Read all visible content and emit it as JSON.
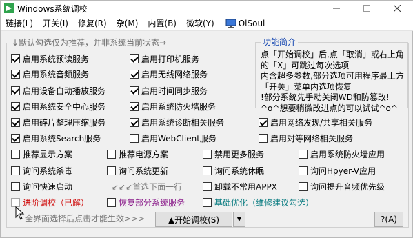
{
  "window": {
    "title": "Windows系统调校"
  },
  "menu": [
    {
      "label": "链接(L)"
    },
    {
      "label": "开关(I)"
    },
    {
      "label": "修复(R)"
    },
    {
      "label": "杂(M)"
    },
    {
      "label": "内置(B)"
    },
    {
      "label": "微软(Y)"
    },
    {
      "label": "OlSoul"
    }
  ],
  "options_group": {
    "legend": "↓默认勾选仅为推荐，并非系统当前状态→"
  },
  "info": {
    "legend": "功能简介",
    "text": "点「开始调校」后,点「取消」或右上角的「X」可跳过每次选项\n内含超多参数,部分选项可用程序最上方「开关」菜单内选项恢复\n!部分系统先手动关闭WD和防篡改!\n^o^想要稍微改进点的可以试试^o^"
  },
  "checkboxes": [
    {
      "label": "启用系统预读服务",
      "checked": true
    },
    {
      "label": "启用打印机服务",
      "checked": true
    },
    {
      "label": "启用系统音频服务",
      "checked": true
    },
    {
      "label": "启用无线网络服务",
      "checked": true
    },
    {
      "label": "启用设备自动播放服务",
      "checked": true
    },
    {
      "label": "启用时间同步服务",
      "checked": true
    },
    {
      "label": "启用系统安全中心服务",
      "checked": true
    },
    {
      "label": "启用系统防火墙服务",
      "checked": true
    },
    {
      "label": "启用碎片整理压缩服务",
      "checked": true
    },
    {
      "label": "启用系统诊断相关服务",
      "checked": true
    },
    {
      "label": "启用网络发现/共享相关服务",
      "checked": true
    },
    {
      "label": "启用系统Search服务",
      "checked": true
    },
    {
      "label": "启用WebClient服务",
      "checked": false
    },
    {
      "label": "启用对等网络相关服务",
      "checked": false
    },
    {
      "label": "推荐显示方案",
      "checked": false
    },
    {
      "label": "推荐电源方案",
      "checked": false
    },
    {
      "label": "禁用更多服务",
      "checked": false
    },
    {
      "label": "启用系统防火墙应用",
      "checked": false
    },
    {
      "label": "询问系统杀毒",
      "checked": false
    },
    {
      "label": "询问系统更新",
      "checked": false
    },
    {
      "label": "询问系统休眠",
      "checked": false
    },
    {
      "label": "询问Hpyer-V应用",
      "checked": false
    },
    {
      "label": "询问快速启动",
      "checked": false
    },
    {
      "label": "卸载不常用APPX",
      "checked": false
    },
    {
      "label": "询问提升音频优先级",
      "checked": false
    },
    {
      "label": "进阶调校（已解）",
      "checked": false
    },
    {
      "label": "恢复部分系统服务",
      "checked": false
    },
    {
      "label": "基础优化（维修建议勾选）",
      "checked": false
    }
  ],
  "hints": {
    "first_select": "↙↙↙首选下面一行",
    "footer": "全界面选择后点击才能生效>>>"
  },
  "buttons": {
    "start": "▲开始调校(S)",
    "start_arrow": "▼",
    "help": "?(A)"
  },
  "colors": {
    "red": "#d01010",
    "purple": "#8a1b8a",
    "teal": "#0e7e83",
    "blue": "#0b3fae"
  }
}
